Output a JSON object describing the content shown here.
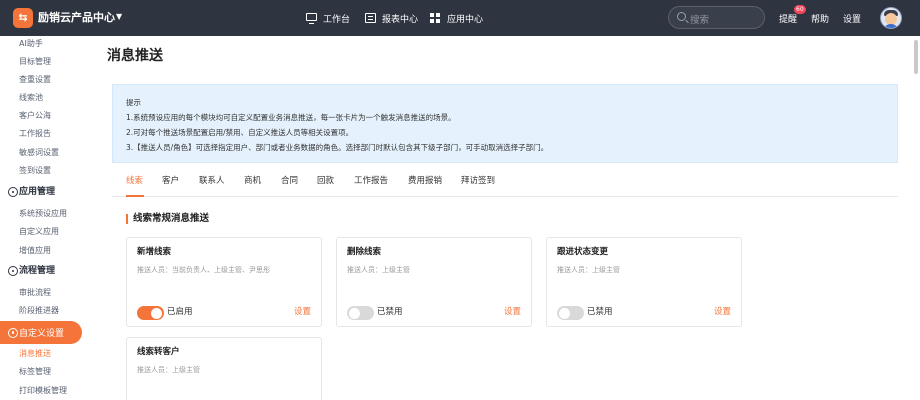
{
  "topbar": {
    "logo_glyph": "⇆",
    "app_title": "励销云产品中心",
    "nav": [
      {
        "label": "工作台",
        "icon": "monitor-icon"
      },
      {
        "label": "报表中心",
        "icon": "report-icon"
      },
      {
        "label": "应用中心",
        "icon": "grid-icon"
      }
    ],
    "search_placeholder": "搜索",
    "remind_label": "提醒",
    "remind_badge": "60",
    "help_label": "帮助",
    "settings_label": "设置"
  },
  "sidebar": {
    "items_top": [
      "AI助手",
      "目标管理",
      "查重设置",
      "线索池",
      "客户公海",
      "工作报告",
      "敏感词设置",
      "签到设置"
    ],
    "group_app": "应用管理",
    "items_app": [
      "系统预设应用",
      "自定义应用",
      "增值应用"
    ],
    "group_flow": "流程管理",
    "items_flow": [
      "审批流程",
      "阶段推进器"
    ],
    "group_custom": "自定义设置",
    "items_custom": [
      "消息推送",
      "标签管理",
      "打印模板管理"
    ]
  },
  "page": {
    "title": "消息推送",
    "tip": [
      "提示",
      "1.系统预设应用的每个模块均可自定义配置业务消息推送，每一张卡片为一个触发消息推送的场景。",
      "2.可对每个推送场景配置启用/禁用、自定义推送人员等相关设置项。",
      "3.【推送人员/角色】可选择指定用户、部门或者业务数据的角色。选择部门时默认包含其下级子部门，可手动取消选择子部门。"
    ],
    "tabs": [
      "线索",
      "客户",
      "联系人",
      "商机",
      "合同",
      "回款",
      "工作报告",
      "费用报销",
      "拜访签到"
    ],
    "active_tab": "线索",
    "section_title": "线索常规消息推送",
    "cards": [
      {
        "title": "新增线索",
        "sub": "推送人员：当前负责人、上级主管、尹思彤",
        "enabled": true,
        "status": "已启用",
        "action": "设置"
      },
      {
        "title": "删除线索",
        "sub": "推送人员：上级主管",
        "enabled": false,
        "status": "已禁用",
        "action": "设置"
      },
      {
        "title": "跟进状态变更",
        "sub": "推送人员：上级主管",
        "enabled": false,
        "status": "已禁用",
        "action": "设置"
      },
      {
        "title": "线索转客户",
        "sub": "推送人员：上级主管"
      }
    ]
  },
  "colors": {
    "accent": "#f5743a",
    "topbar": "#2f3441",
    "tip_bg": "#e5f2fd"
  }
}
